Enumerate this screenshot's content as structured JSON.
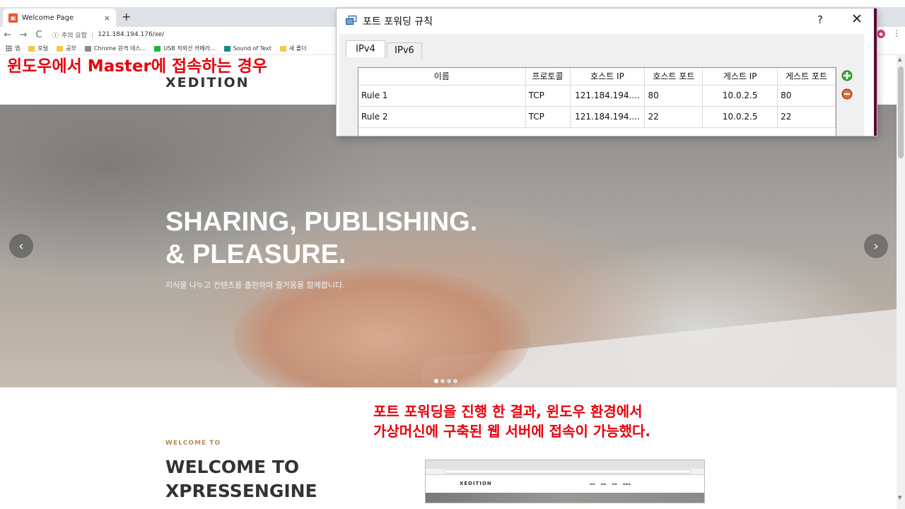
{
  "browser": {
    "tab_title": "Welcome Page",
    "tab_close": "×",
    "new_tab": "+",
    "nav_back": "←",
    "nav_forward": "→",
    "nav_reload": "C",
    "security_icon": "ⓘ",
    "security_text": "주의 요함",
    "url": "121.184.194.176/xe/",
    "menu": "⋮",
    "bookmarks": [
      {
        "label": "앱",
        "icon": "apps-grid"
      },
      {
        "label": "포털",
        "icon": "folder"
      },
      {
        "label": "공부",
        "icon": "folder"
      },
      {
        "label": "Chrome 원격 데스...",
        "icon": "remote-desktop"
      },
      {
        "label": "USB 적외선 카메라...",
        "icon": "plus-box"
      },
      {
        "label": "Sound of Text",
        "icon": "speaker"
      },
      {
        "label": "새 폴더",
        "icon": "folder"
      }
    ]
  },
  "annotations": {
    "top": "윈도우에서 Master에 접속하는 경우",
    "bottom_line1": "포트 포워딩을 진행 한 결과, 윈도우 환경에서",
    "bottom_line2": "가상머신에 구축된 웹 서버에 접속이 가능했다."
  },
  "site": {
    "logo": "XEDITION",
    "hero_title_line1": "SHARING, PUBLISHING.",
    "hero_title_line2": "& PLEASURE.",
    "hero_subtitle": "지식을 나누고 컨텐츠를 출판하며 즐거움을 함께합니다.",
    "arrow_left": "‹",
    "arrow_right": "›",
    "slides": 4,
    "active_slide": 1,
    "welcome_small": "WELCOME TO",
    "welcome_big_line1": "WELCOME TO",
    "welcome_big_line2": "XPRESSENGINE",
    "mini_logo": "XEDITION"
  },
  "dialog": {
    "title": "포트 포워딩 규칙",
    "help": "?",
    "close": "✕",
    "tabs": [
      "IPv4",
      "IPv6"
    ],
    "active_tab": "IPv4",
    "columns": [
      "이름",
      "프로토콜",
      "호스트 IP",
      "호스트 포트",
      "게스트 IP",
      "게스트 포트"
    ],
    "rows": [
      [
        "Rule 1",
        "TCP",
        "121.184.194....",
        "80",
        "10.0.2.5",
        "80"
      ],
      [
        "Rule 2",
        "TCP",
        "121.184.194....",
        "22",
        "10.0.2.5",
        "22"
      ]
    ]
  },
  "colors": {
    "annotation": "#e8000b",
    "welcome_accent": "#b38b59",
    "dialog_edge": "#5b0a3b"
  }
}
